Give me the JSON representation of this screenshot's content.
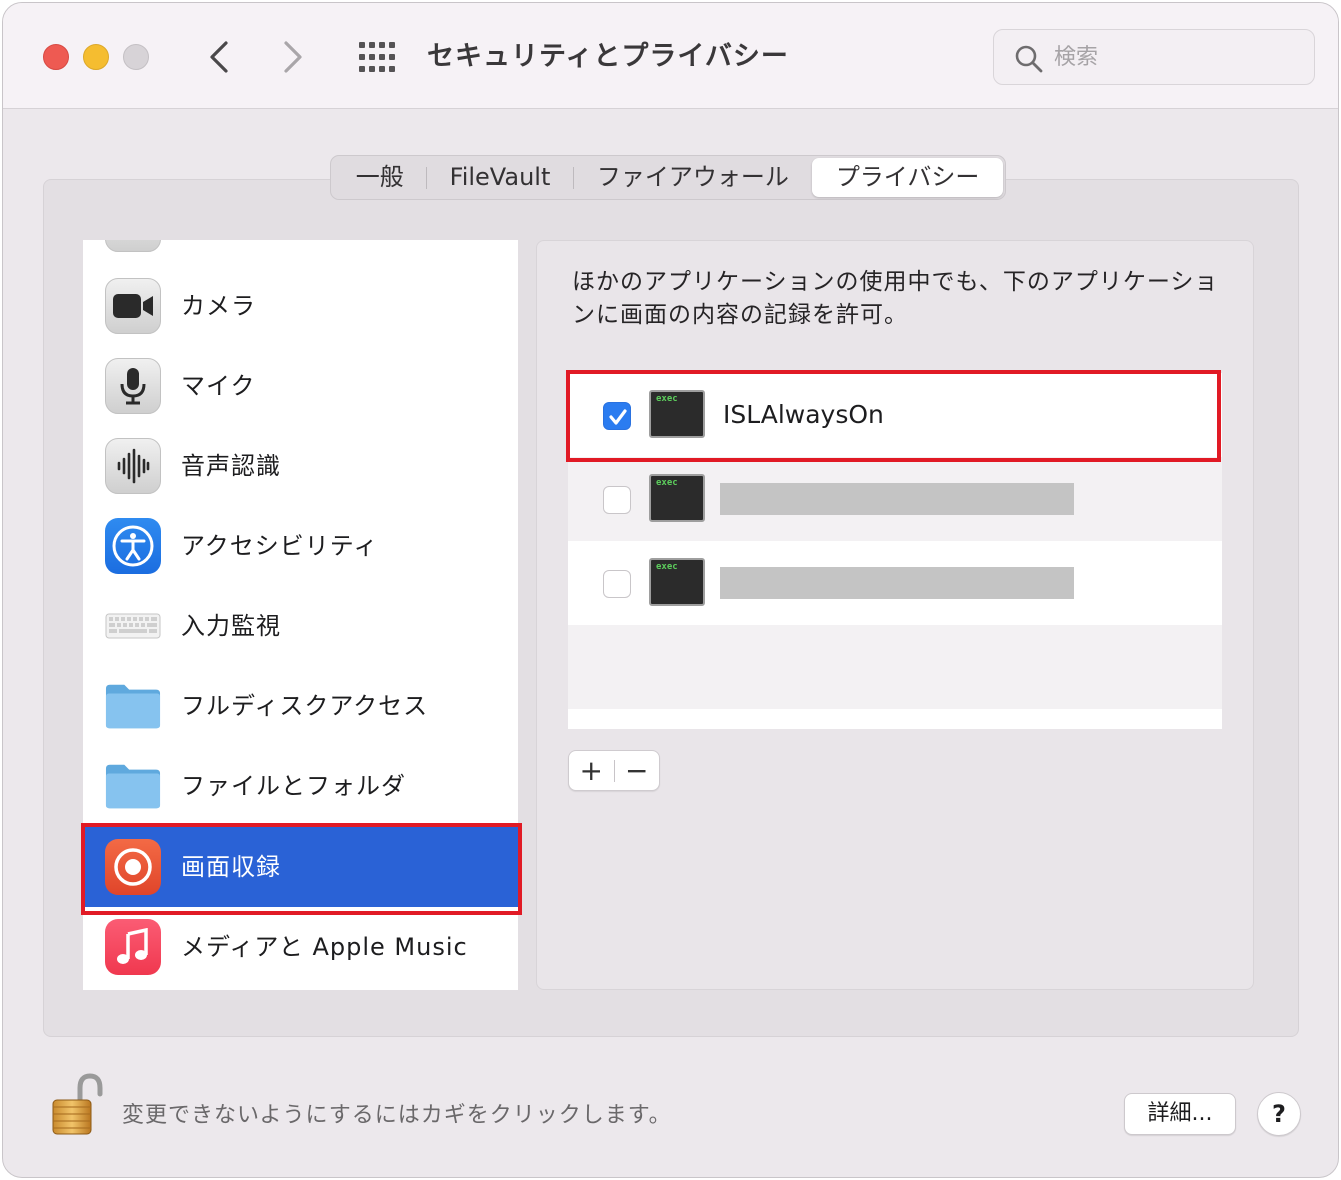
{
  "window": {
    "title": "セキュリティとプライバシー"
  },
  "search": {
    "placeholder": "検索",
    "value": ""
  },
  "tabs": [
    {
      "label": "一般",
      "selected": false
    },
    {
      "label": "FileVault",
      "selected": false
    },
    {
      "label": "ファイアウォール",
      "selected": false
    },
    {
      "label": "プライバシー",
      "selected": true
    }
  ],
  "sidebar": {
    "items": [
      {
        "label": "",
        "icon": "siri-icon"
      },
      {
        "label": "カメラ",
        "icon": "camera-icon"
      },
      {
        "label": "マイク",
        "icon": "microphone-icon"
      },
      {
        "label": "音声認識",
        "icon": "waveform-icon"
      },
      {
        "label": "アクセシビリティ",
        "icon": "accessibility-icon"
      },
      {
        "label": "入力監視",
        "icon": "keyboard-icon"
      },
      {
        "label": "フルディスクアクセス",
        "icon": "folder-icon"
      },
      {
        "label": "ファイルとフォルダ",
        "icon": "folder-icon"
      },
      {
        "label": "画面収録",
        "icon": "screen-record-icon",
        "selected": true
      },
      {
        "label": "メディアと Apple Music",
        "icon": "music-icon"
      }
    ]
  },
  "pane": {
    "description": "ほかのアプリケーションの使用中でも、下のアプリケーションに画面の内容の記録を許可。",
    "apps": [
      {
        "name": "ISLAlwaysOn",
        "checked": true,
        "icon_text": "exec"
      },
      {
        "name": "",
        "checked": false,
        "icon_text": "exec",
        "redacted": true
      },
      {
        "name": "",
        "checked": false,
        "icon_text": "exec",
        "redacted": true
      }
    ],
    "add_label": "+",
    "remove_label": "−"
  },
  "footer": {
    "lock_text": "変更できないようにするにはカギをクリックします。",
    "details_label": "詳細...",
    "help_label": "?"
  },
  "colors": {
    "selection": "#2a62d6",
    "highlight": "#e11a25",
    "checkbox": "#2b7cf0"
  }
}
